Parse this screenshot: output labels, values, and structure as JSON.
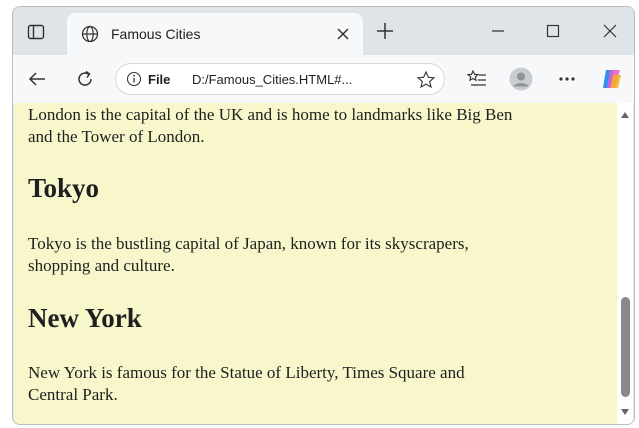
{
  "browser": {
    "tab": {
      "title": "Famous Cities"
    },
    "address": {
      "scheme": "File",
      "url": "D:/Famous_Cities.HTML#..."
    }
  },
  "page": {
    "london_text_line1": "London is the capital of the UK and is home to landmarks like Big Ben",
    "london_text_line2": "and the Tower of London.",
    "tokyo_heading": "Tokyo",
    "tokyo_text_line1": "Tokyo is the bustling capital of Japan, known for its skyscrapers,",
    "tokyo_text_line2": "shopping and culture.",
    "newyork_heading": "New York",
    "newyork_text_line1": "New York is famous for the Statue of Liberty, Times Square and",
    "newyork_text_line2": "Central Park."
  },
  "colors": {
    "page_background": "#f8f6cb",
    "tab_background": "#f7f8f9",
    "tabbar_background": "#dfe4e8"
  },
  "icons": [
    "tab-actions-icon",
    "globe-icon",
    "close-tab-icon",
    "new-tab-icon",
    "minimize-icon",
    "maximize-icon",
    "close-window-icon",
    "back-icon",
    "reload-icon",
    "info-icon",
    "favorite-star-icon",
    "reading-list-icon",
    "profile-icon",
    "more-icon",
    "copilot-icon"
  ]
}
